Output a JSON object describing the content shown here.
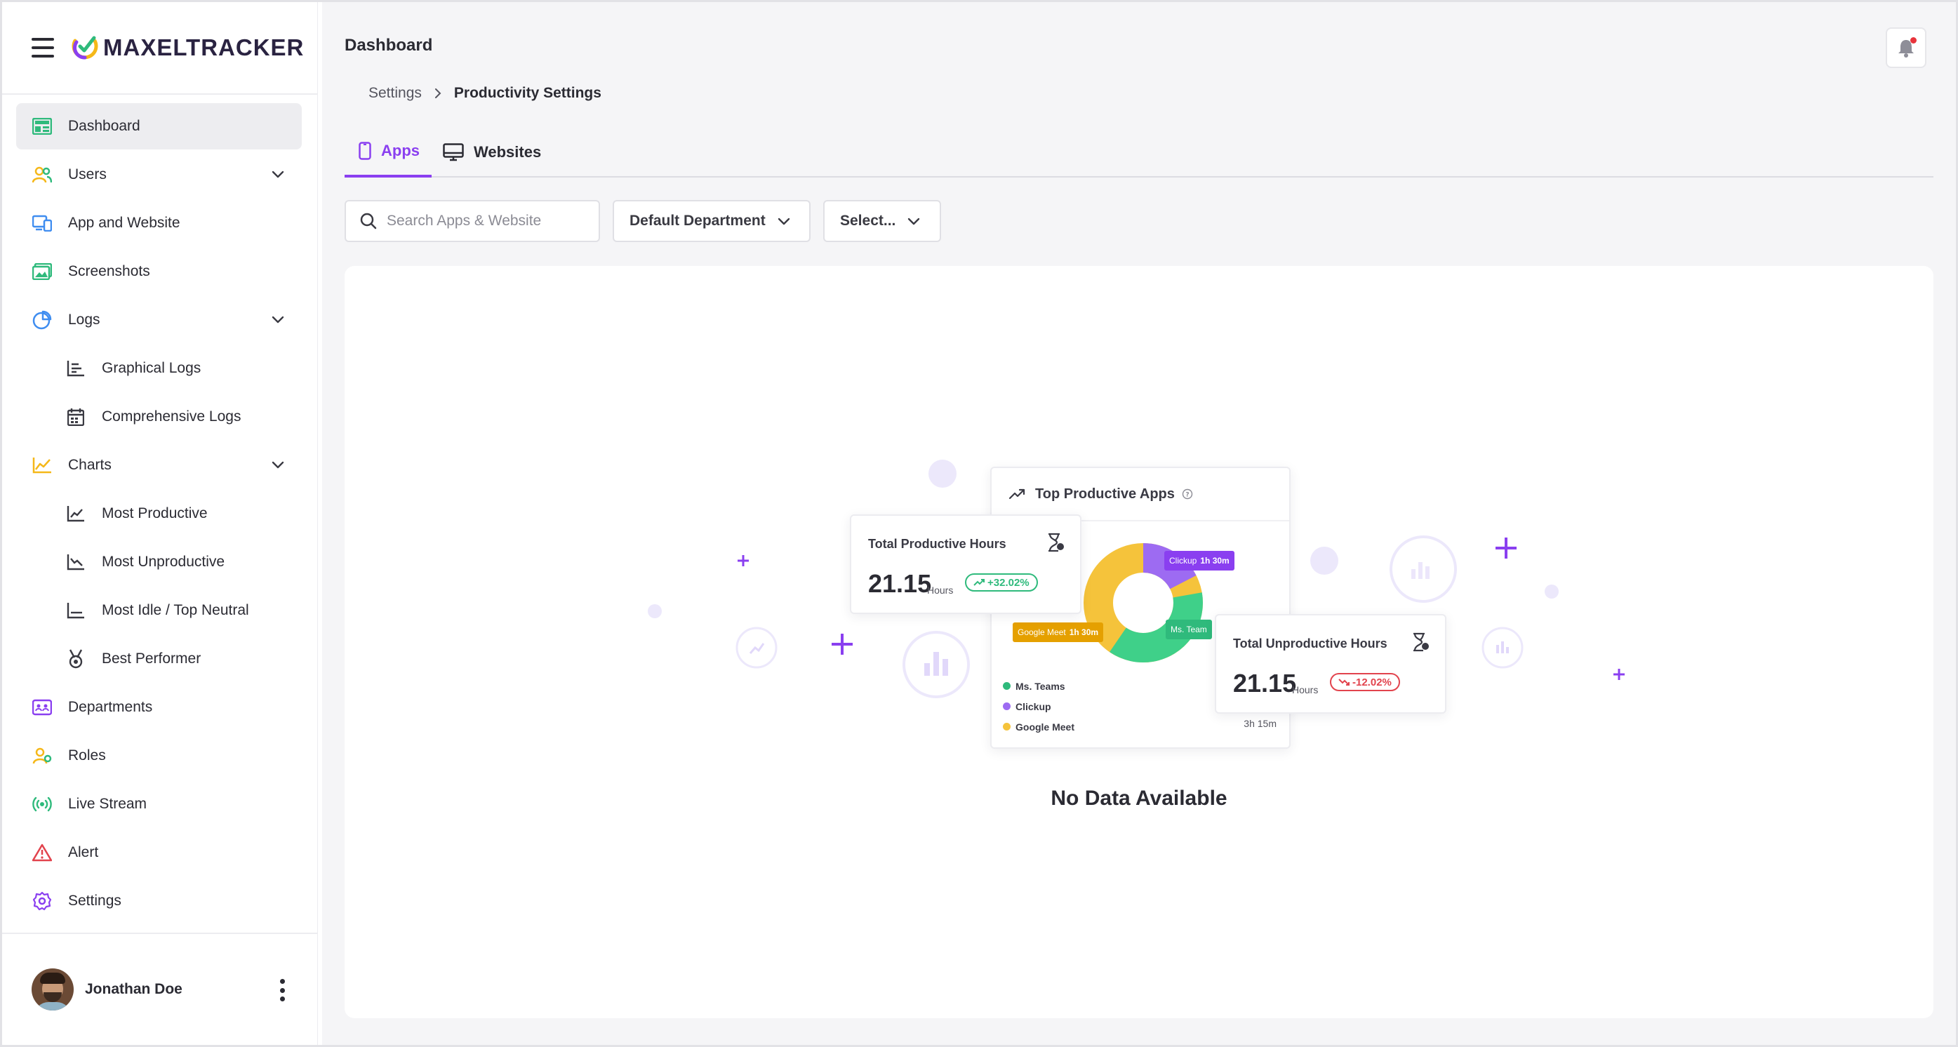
{
  "app": {
    "brand": "MAXELTRACKER",
    "accent": "#8a3ff0"
  },
  "sidebar": {
    "items": [
      {
        "label": "Dashboard",
        "icon": "dashboard-icon"
      },
      {
        "label": "Users",
        "icon": "users-icon"
      },
      {
        "label": "App and Website",
        "icon": "devices-icon"
      },
      {
        "label": "Screenshots",
        "icon": "image-icon"
      },
      {
        "label": "Logs",
        "icon": "pie-chart-icon"
      },
      {
        "label": "Graphical Logs",
        "icon": "bar-chart-icon"
      },
      {
        "label": "Comprehensive Logs",
        "icon": "calendar-icon"
      },
      {
        "label": "Charts",
        "icon": "line-chart-icon"
      },
      {
        "label": "Most Productive",
        "icon": "trend-up-icon"
      },
      {
        "label": "Most Unproductive",
        "icon": "trend-down-icon"
      },
      {
        "label": "Most Idle / Top Neutral",
        "icon": "flat-chart-icon"
      },
      {
        "label": "Best Performer",
        "icon": "medal-icon"
      },
      {
        "label": "Departments",
        "icon": "departments-icon"
      },
      {
        "label": "Roles",
        "icon": "roles-icon"
      },
      {
        "label": "Live Stream",
        "icon": "broadcast-icon"
      },
      {
        "label": "Alert",
        "icon": "alert-icon"
      },
      {
        "label": "Settings",
        "icon": "gear-icon"
      }
    ],
    "user": {
      "name": "Jonathan Doe"
    }
  },
  "header": {
    "title": "Dashboard",
    "breadcrumb": {
      "parent": "Settings",
      "current": "Productivity Settings"
    }
  },
  "tabs": [
    {
      "label": "Apps",
      "icon": "phone-icon"
    },
    {
      "label": "Websites",
      "icon": "monitor-icon"
    }
  ],
  "filters": {
    "search_placeholder": "Search Apps & Website",
    "department": "Default Department",
    "select": "Select..."
  },
  "empty_state": {
    "message": "No Data Available",
    "top_card": {
      "title": "Top Productive Apps",
      "legend": [
        "Ms. Teams",
        "Clickup",
        "Google Meet"
      ],
      "legend_value": "3h 15m",
      "tags": [
        {
          "app": "Clickup",
          "time": "1h 30m"
        },
        {
          "app": "Google Meet",
          "time": "1h 30m"
        },
        {
          "app": "Ms. Team",
          "time": ""
        }
      ]
    },
    "productive_card": {
      "title": "Total Productive Hours",
      "value": "21.15",
      "unit": "Hours",
      "change": "+32.02%"
    },
    "unproductive_card": {
      "title": "Total Unproductive Hours",
      "value": "21.15",
      "unit": "Hours",
      "change": "-12.02%"
    }
  }
}
